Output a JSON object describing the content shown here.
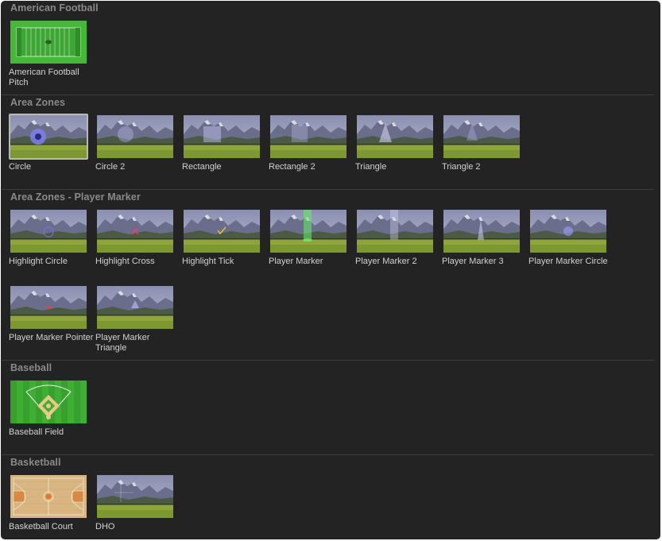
{
  "sections": [
    {
      "title": "American Football",
      "items": [
        {
          "label": "American Football Pitch"
        }
      ]
    },
    {
      "title": "Area Zones",
      "items": [
        {
          "label": "Circle"
        },
        {
          "label": "Circle 2"
        },
        {
          "label": "Rectangle"
        },
        {
          "label": "Rectangle 2"
        },
        {
          "label": "Triangle"
        },
        {
          "label": "Triangle 2"
        }
      ]
    },
    {
      "title": "Area Zones - Player Marker",
      "items": [
        {
          "label": "Highlight Circle"
        },
        {
          "label": "Highlight Cross"
        },
        {
          "label": "Highlight Tick"
        },
        {
          "label": "Player Marker"
        },
        {
          "label": "Player Marker 2"
        },
        {
          "label": "Player Marker 3"
        },
        {
          "label": "Player Marker Circle"
        },
        {
          "label": "Player Marker Pointer"
        },
        {
          "label": "Player Marker Triangle"
        }
      ]
    },
    {
      "title": "Baseball",
      "items": [
        {
          "label": "Baseball Field"
        }
      ]
    },
    {
      "title": "Basketball",
      "items": [
        {
          "label": "Basketball Court"
        },
        {
          "label": "DHO"
        }
      ]
    }
  ],
  "selected_item": "Circle",
  "colors": {
    "panel_bg": "#232323",
    "section_title": "#8a8a8a",
    "label": "#d2d2d2",
    "divider": "#3c3c3c",
    "selection_border": "#b9b9b9"
  }
}
